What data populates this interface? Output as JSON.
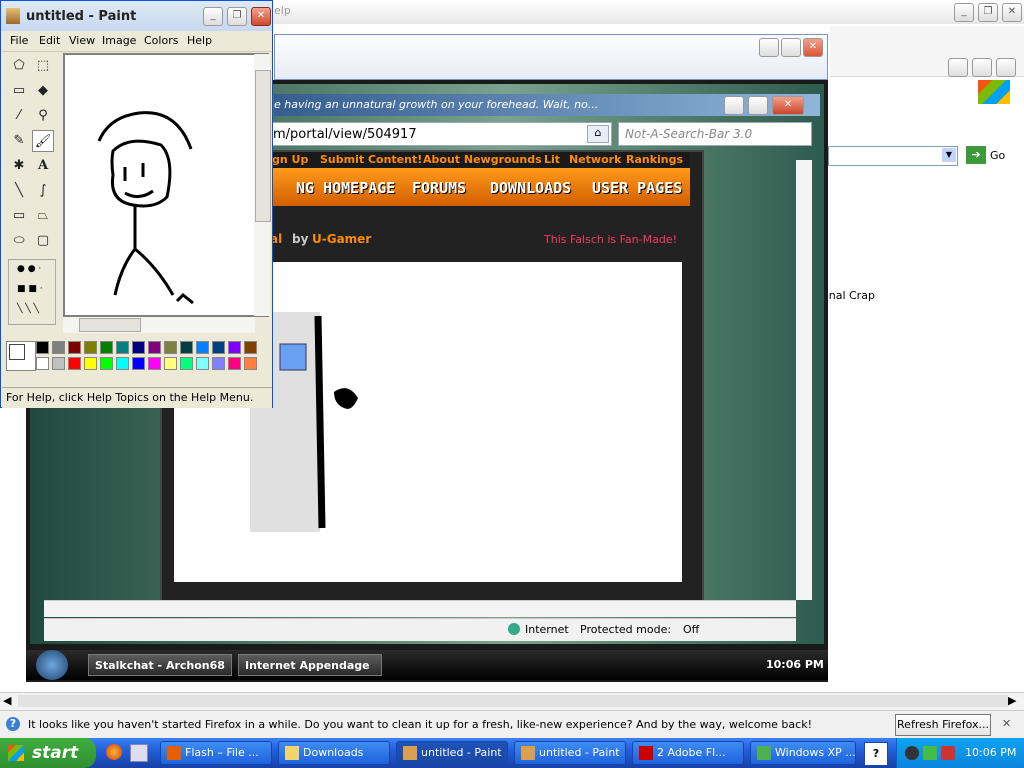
{
  "background_window": {
    "title_fragment": "elp",
    "controls": [
      "_",
      "❐",
      "✕"
    ],
    "right_panel_text": "onal Crap",
    "go_label": "Go"
  },
  "notification": {
    "message": "It looks like you haven't started Firefox in a while. Do you want to clean it up for a fresh, like-new experience? And by the way, welcome back!",
    "button_label": "Refresh Firefox...",
    "close_label": "✕"
  },
  "vista_screenshot": {
    "banner_text": "e having an unnatural growth on your forehead. Wait, no...",
    "address": "m/portal/view/504917",
    "search_placeholder": "Not-A-Search-Bar 3.0",
    "top_links": [
      "gn Up",
      "Submit Content!",
      "About Newgrounds",
      "Lit",
      "Network",
      "Rankings"
    ],
    "nav": [
      "NG HOMEPAGE",
      "FORUMS",
      "DOWNLOADS",
      "USER PAGES"
    ],
    "title_suffix": "al",
    "by_label": "by",
    "author": "U-Gamer",
    "fan_made": "This Falsch is Fan-Made!",
    "status_zone": "Internet",
    "status_protected": "Protected mode:",
    "status_off": "Off",
    "taskbar_items": [
      "Stalkchat - Archon68",
      "Internet Appendage"
    ],
    "clock": "10:06 PM"
  },
  "paint": {
    "title": "untitled - Paint",
    "menu": [
      "File",
      "Edit",
      "View",
      "Image",
      "Colors",
      "Help"
    ],
    "status": "For Help, click Help Topics on the Help Menu.",
    "palette_row1": [
      "#000000",
      "#808080",
      "#800000",
      "#808000",
      "#008000",
      "#008080",
      "#000080",
      "#800080",
      "#808040",
      "#004040",
      "#0080ff",
      "#004080",
      "#8000ff",
      "#804000"
    ],
    "palette_row2": [
      "#ffffff",
      "#c0c0c0",
      "#ff0000",
      "#ffff00",
      "#00ff00",
      "#00ffff",
      "#0000ff",
      "#ff00ff",
      "#ffff80",
      "#00ff80",
      "#80ffff",
      "#8080ff",
      "#ff0080",
      "#ff8040"
    ]
  },
  "taskbar": {
    "start_label": "start",
    "items": [
      {
        "label": "Flash – File ...",
        "icon": "firefox-icon"
      },
      {
        "label": "Downloads",
        "icon": "folder-icon"
      },
      {
        "label": "untitled - Paint",
        "icon": "paint-icon",
        "active": true
      },
      {
        "label": "untitled - Paint",
        "icon": "paint-icon"
      },
      {
        "label": "2 Adobe Fl...",
        "icon": "flash-icon"
      },
      {
        "label": "Windows XP ...",
        "icon": "chrome-icon"
      }
    ],
    "clock": "10:06 PM"
  }
}
